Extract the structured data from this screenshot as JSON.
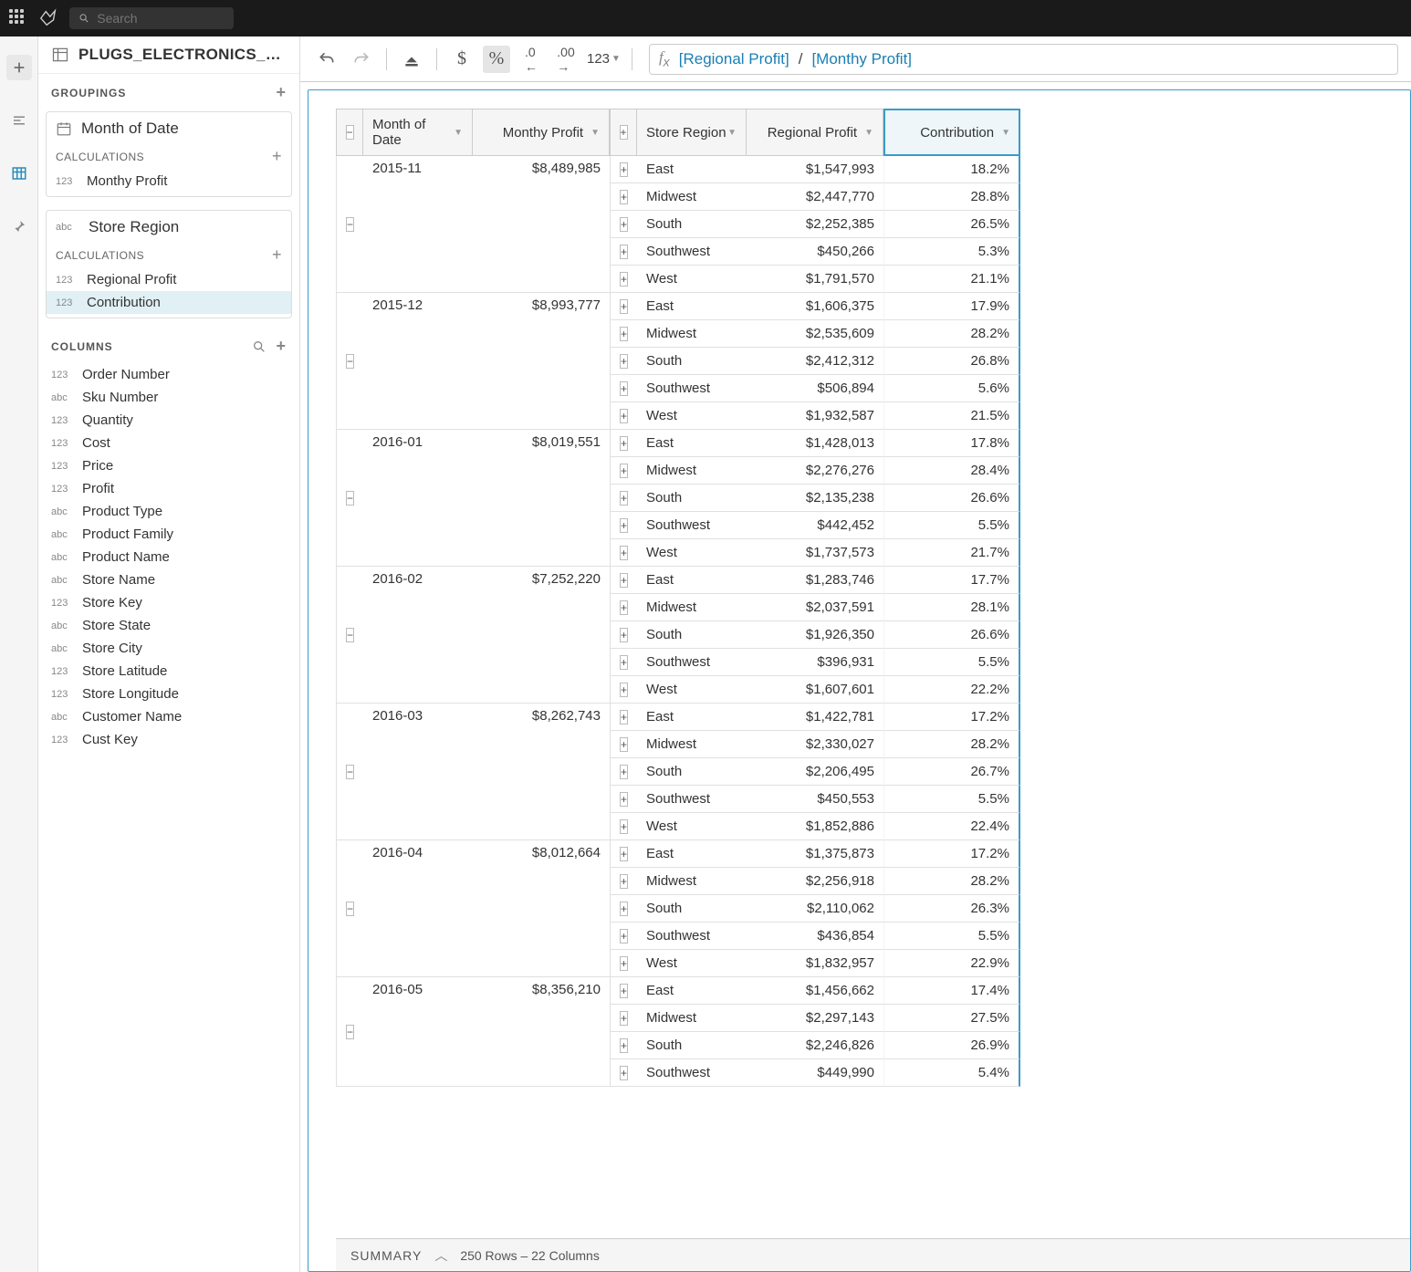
{
  "search_placeholder": "Search",
  "dataset_title": "PLUGS_ELECTRONICS_HAND…",
  "sidebar": {
    "groupings_label": "GROUPINGS",
    "calculations_label": "CALCULATIONS",
    "columns_label": "COLUMNS",
    "group1": {
      "title": "Month of Date",
      "calcs": [
        {
          "type": "123",
          "name": "Monthy Profit"
        }
      ]
    },
    "group2": {
      "title": "Store Region",
      "calcs": [
        {
          "type": "123",
          "name": "Regional Profit"
        },
        {
          "type": "123",
          "name": "Contribution"
        }
      ]
    },
    "columns": [
      {
        "type": "123",
        "name": "Order Number"
      },
      {
        "type": "abc",
        "name": "Sku Number"
      },
      {
        "type": "123",
        "name": "Quantity"
      },
      {
        "type": "123",
        "name": "Cost"
      },
      {
        "type": "123",
        "name": "Price"
      },
      {
        "type": "123",
        "name": "Profit"
      },
      {
        "type": "abc",
        "name": "Product Type"
      },
      {
        "type": "abc",
        "name": "Product Family"
      },
      {
        "type": "abc",
        "name": "Product Name"
      },
      {
        "type": "abc",
        "name": "Store Name"
      },
      {
        "type": "123",
        "name": "Store Key"
      },
      {
        "type": "abc",
        "name": "Store State"
      },
      {
        "type": "abc",
        "name": "Store City"
      },
      {
        "type": "123",
        "name": "Store Latitude"
      },
      {
        "type": "123",
        "name": "Store Longitude"
      },
      {
        "type": "abc",
        "name": "Customer Name"
      },
      {
        "type": "123",
        "name": "Cust Key"
      }
    ]
  },
  "toolbar": {
    "format_label": "123"
  },
  "formula": {
    "token1": "[Regional Profit]",
    "op": "/",
    "token2": "[Monthy Profit]"
  },
  "headers": {
    "month": "Month of Date",
    "monthly_profit": "Monthy Profit",
    "region": "Store Region",
    "regional_profit": "Regional Profit",
    "contribution": "Contribution"
  },
  "rows": [
    {
      "month": "2015-11",
      "profit": "$8,489,985",
      "regions": [
        {
          "r": "East",
          "p": "$1,547,993",
          "c": "18.2%"
        },
        {
          "r": "Midwest",
          "p": "$2,447,770",
          "c": "28.8%"
        },
        {
          "r": "South",
          "p": "$2,252,385",
          "c": "26.5%"
        },
        {
          "r": "Southwest",
          "p": "$450,266",
          "c": "5.3%"
        },
        {
          "r": "West",
          "p": "$1,791,570",
          "c": "21.1%"
        }
      ]
    },
    {
      "month": "2015-12",
      "profit": "$8,993,777",
      "regions": [
        {
          "r": "East",
          "p": "$1,606,375",
          "c": "17.9%"
        },
        {
          "r": "Midwest",
          "p": "$2,535,609",
          "c": "28.2%"
        },
        {
          "r": "South",
          "p": "$2,412,312",
          "c": "26.8%"
        },
        {
          "r": "Southwest",
          "p": "$506,894",
          "c": "5.6%"
        },
        {
          "r": "West",
          "p": "$1,932,587",
          "c": "21.5%"
        }
      ]
    },
    {
      "month": "2016-01",
      "profit": "$8,019,551",
      "regions": [
        {
          "r": "East",
          "p": "$1,428,013",
          "c": "17.8%"
        },
        {
          "r": "Midwest",
          "p": "$2,276,276",
          "c": "28.4%"
        },
        {
          "r": "South",
          "p": "$2,135,238",
          "c": "26.6%"
        },
        {
          "r": "Southwest",
          "p": "$442,452",
          "c": "5.5%"
        },
        {
          "r": "West",
          "p": "$1,737,573",
          "c": "21.7%"
        }
      ]
    },
    {
      "month": "2016-02",
      "profit": "$7,252,220",
      "regions": [
        {
          "r": "East",
          "p": "$1,283,746",
          "c": "17.7%"
        },
        {
          "r": "Midwest",
          "p": "$2,037,591",
          "c": "28.1%"
        },
        {
          "r": "South",
          "p": "$1,926,350",
          "c": "26.6%"
        },
        {
          "r": "Southwest",
          "p": "$396,931",
          "c": "5.5%"
        },
        {
          "r": "West",
          "p": "$1,607,601",
          "c": "22.2%"
        }
      ]
    },
    {
      "month": "2016-03",
      "profit": "$8,262,743",
      "regions": [
        {
          "r": "East",
          "p": "$1,422,781",
          "c": "17.2%"
        },
        {
          "r": "Midwest",
          "p": "$2,330,027",
          "c": "28.2%"
        },
        {
          "r": "South",
          "p": "$2,206,495",
          "c": "26.7%"
        },
        {
          "r": "Southwest",
          "p": "$450,553",
          "c": "5.5%"
        },
        {
          "r": "West",
          "p": "$1,852,886",
          "c": "22.4%"
        }
      ]
    },
    {
      "month": "2016-04",
      "profit": "$8,012,664",
      "regions": [
        {
          "r": "East",
          "p": "$1,375,873",
          "c": "17.2%"
        },
        {
          "r": "Midwest",
          "p": "$2,256,918",
          "c": "28.2%"
        },
        {
          "r": "South",
          "p": "$2,110,062",
          "c": "26.3%"
        },
        {
          "r": "Southwest",
          "p": "$436,854",
          "c": "5.5%"
        },
        {
          "r": "West",
          "p": "$1,832,957",
          "c": "22.9%"
        }
      ]
    },
    {
      "month": "2016-05",
      "profit": "$8,356,210",
      "regions": [
        {
          "r": "East",
          "p": "$1,456,662",
          "c": "17.4%"
        },
        {
          "r": "Midwest",
          "p": "$2,297,143",
          "c": "27.5%"
        },
        {
          "r": "South",
          "p": "$2,246,826",
          "c": "26.9%"
        },
        {
          "r": "Southwest",
          "p": "$449,990",
          "c": "5.4%"
        }
      ]
    }
  ],
  "summary": {
    "label": "SUMMARY",
    "text": "250 Rows – 22 Columns"
  }
}
